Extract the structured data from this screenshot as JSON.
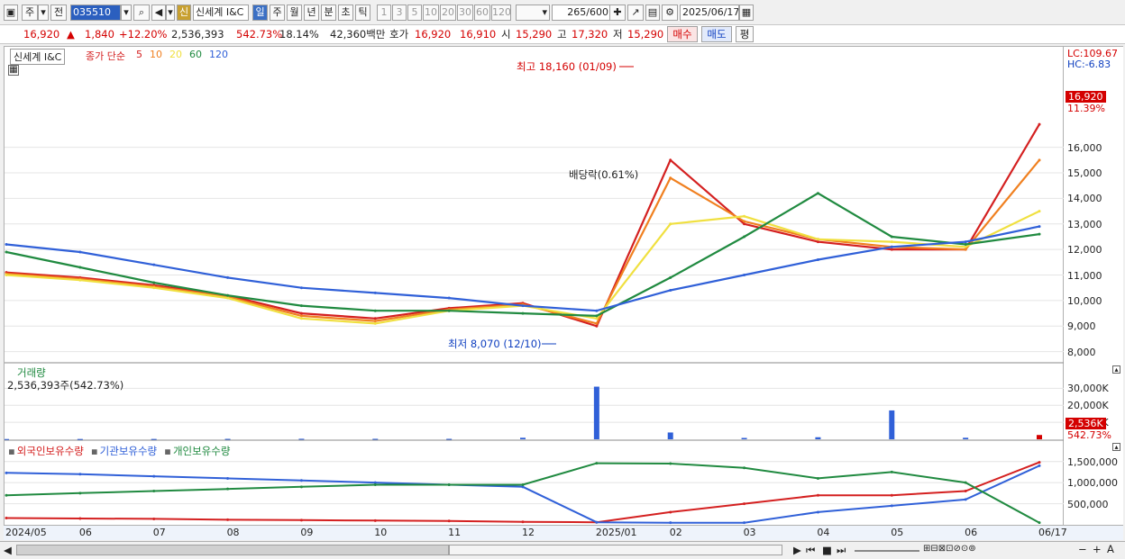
{
  "toolbar": {
    "type_label": "주",
    "scope_label": "전",
    "code": "035510",
    "credit_badge": "신",
    "stock_name": "신세계 I&C",
    "periods": [
      "일",
      "주",
      "월",
      "년",
      "분",
      "초",
      "틱"
    ],
    "selected_period": "일",
    "intervals": [
      "1",
      "3",
      "5",
      "10",
      "20",
      "30",
      "60",
      "120"
    ],
    "count": "265",
    "count_total": "/600",
    "date": "2025/06/17"
  },
  "quote": {
    "price": "16,920",
    "change": "1,840",
    "change_pct": "+12.20%",
    "volume": "2,536,393",
    "volume_ratio": "542.73%",
    "turnover": "18.14%",
    "amount": "42,360백만",
    "bid_label": "호가",
    "ask": "16,920",
    "bid": "16,910",
    "open_label": "시",
    "open": "15,290",
    "high_label": "고",
    "high": "17,320",
    "low_label": "저",
    "low": "15,290",
    "buy_button": "매수",
    "sell_button": "매도",
    "eval_button": "평"
  },
  "price_pane": {
    "name": "신세계 I&C",
    "ma_label": "종가 단순",
    "ma_periods": [
      "5",
      "10",
      "20",
      "60",
      "120"
    ],
    "ma_colors": [
      "#d42020",
      "#f08020",
      "#f0e040",
      "#208a40",
      "#3060d8"
    ],
    "max_annot": "최고 18,160 (01/09)",
    "min_annot": "최저 8,070 (12/10)",
    "dividend_annot": "배당락(0.61%)",
    "lc": "LC:109.67",
    "hc": "HC:-6.83",
    "current_price": "16,920",
    "current_pct": "11.39%"
  },
  "volume_pane": {
    "title": "거래량",
    "value": "2,536,393주(542.73%)",
    "current": "2,536K",
    "current_pct": "542.73%"
  },
  "holding_pane": {
    "legends": [
      "외국인보유수량",
      "기관보유수량",
      "개인보유수량"
    ],
    "legend_colors": [
      "#d42020",
      "#3060d8",
      "#208a40"
    ]
  },
  "x_axis_labels": [
    "2024/05",
    "06",
    "07",
    "08",
    "09",
    "10",
    "11",
    "12",
    "2025/01",
    "02",
    "03",
    "04",
    "05",
    "06",
    "06/17"
  ],
  "chart_data": [
    {
      "type": "line",
      "pane": "price",
      "ylim": [
        7600,
        19300
      ],
      "yticks": [
        "16,000",
        "15,000",
        "14,000",
        "13,000",
        "12,000",
        "11,000",
        "10,000",
        "9,000",
        "8,000"
      ],
      "x": [
        "2024/05",
        "06",
        "07",
        "08",
        "09",
        "10",
        "11",
        "12",
        "2025/01",
        "02",
        "03",
        "04",
        "05",
        "06",
        "06/17"
      ],
      "series": [
        {
          "name": "5",
          "values": [
            11100,
            10900,
            10600,
            10200,
            9500,
            9300,
            9700,
            9900,
            9000,
            15500,
            13000,
            12300,
            12000,
            12000,
            16900
          ]
        },
        {
          "name": "10",
          "values": [
            11050,
            10850,
            10550,
            10150,
            9400,
            9200,
            9650,
            9850,
            9100,
            14800,
            13100,
            12400,
            12100,
            12000,
            15500
          ]
        },
        {
          "name": "20",
          "values": [
            11000,
            10800,
            10500,
            10100,
            9300,
            9100,
            9600,
            9800,
            9300,
            13000,
            13300,
            12400,
            12300,
            12100,
            13500
          ]
        },
        {
          "name": "60",
          "values": [
            11900,
            11300,
            10700,
            10200,
            9800,
            9600,
            9600,
            9500,
            9400,
            10900,
            12500,
            14200,
            12500,
            12200,
            12600
          ]
        },
        {
          "name": "120",
          "values": [
            12200,
            11900,
            11400,
            10900,
            10500,
            10300,
            10100,
            9800,
            9600,
            10400,
            11000,
            11600,
            12100,
            12300,
            12900
          ]
        }
      ]
    },
    {
      "type": "bar",
      "pane": "volume",
      "ylim": [
        0,
        35000
      ],
      "yticks": [
        "30,000K",
        "20,000K",
        "10,000K"
      ],
      "categories": [
        "2024/05",
        "06",
        "07",
        "08",
        "09",
        "10",
        "11",
        "12",
        "2025/01",
        "02",
        "03",
        "04",
        "05",
        "06",
        "06/17"
      ],
      "values": [
        150,
        180,
        200,
        250,
        300,
        280,
        260,
        900,
        31000,
        4000,
        800,
        1200,
        17000,
        900,
        2536
      ]
    },
    {
      "type": "line",
      "pane": "holdings",
      "ylim": [
        0,
        1600000
      ],
      "yticks": [
        "1,500,000",
        "1,000,000",
        "500,000"
      ],
      "x": [
        "2024/05",
        "06",
        "07",
        "08",
        "09",
        "10",
        "11",
        "12",
        "2025/01",
        "02",
        "03",
        "04",
        "05",
        "06",
        "06/17"
      ],
      "series": [
        {
          "name": "외국인보유수량",
          "values": [
            160000,
            150000,
            140000,
            120000,
            110000,
            100000,
            90000,
            70000,
            60000,
            300000,
            500000,
            700000,
            700000,
            800000,
            1480000
          ]
        },
        {
          "name": "기관보유수량",
          "values": [
            1230000,
            1200000,
            1150000,
            1100000,
            1050000,
            1000000,
            950000,
            900000,
            60000,
            50000,
            50000,
            300000,
            450000,
            600000,
            1400000
          ]
        },
        {
          "name": "개인보유수량",
          "values": [
            700000,
            750000,
            800000,
            850000,
            900000,
            950000,
            950000,
            950000,
            1460000,
            1450000,
            1350000,
            1100000,
            1250000,
            1000000,
            50000
          ]
        }
      ]
    }
  ]
}
